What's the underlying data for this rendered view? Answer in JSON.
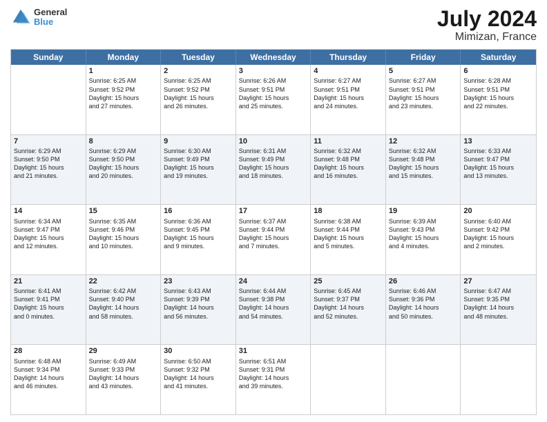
{
  "header": {
    "logo_line1": "General",
    "logo_line2": "Blue",
    "title": "July 2024",
    "subtitle": "Mimizan, France"
  },
  "weekdays": [
    "Sunday",
    "Monday",
    "Tuesday",
    "Wednesday",
    "Thursday",
    "Friday",
    "Saturday"
  ],
  "rows": [
    [
      {
        "day": "",
        "info": ""
      },
      {
        "day": "1",
        "info": "Sunrise: 6:25 AM\nSunset: 9:52 PM\nDaylight: 15 hours\nand 27 minutes."
      },
      {
        "day": "2",
        "info": "Sunrise: 6:25 AM\nSunset: 9:52 PM\nDaylight: 15 hours\nand 26 minutes."
      },
      {
        "day": "3",
        "info": "Sunrise: 6:26 AM\nSunset: 9:51 PM\nDaylight: 15 hours\nand 25 minutes."
      },
      {
        "day": "4",
        "info": "Sunrise: 6:27 AM\nSunset: 9:51 PM\nDaylight: 15 hours\nand 24 minutes."
      },
      {
        "day": "5",
        "info": "Sunrise: 6:27 AM\nSunset: 9:51 PM\nDaylight: 15 hours\nand 23 minutes."
      },
      {
        "day": "6",
        "info": "Sunrise: 6:28 AM\nSunset: 9:51 PM\nDaylight: 15 hours\nand 22 minutes."
      }
    ],
    [
      {
        "day": "7",
        "info": "Sunrise: 6:29 AM\nSunset: 9:50 PM\nDaylight: 15 hours\nand 21 minutes."
      },
      {
        "day": "8",
        "info": "Sunrise: 6:29 AM\nSunset: 9:50 PM\nDaylight: 15 hours\nand 20 minutes."
      },
      {
        "day": "9",
        "info": "Sunrise: 6:30 AM\nSunset: 9:49 PM\nDaylight: 15 hours\nand 19 minutes."
      },
      {
        "day": "10",
        "info": "Sunrise: 6:31 AM\nSunset: 9:49 PM\nDaylight: 15 hours\nand 18 minutes."
      },
      {
        "day": "11",
        "info": "Sunrise: 6:32 AM\nSunset: 9:48 PM\nDaylight: 15 hours\nand 16 minutes."
      },
      {
        "day": "12",
        "info": "Sunrise: 6:32 AM\nSunset: 9:48 PM\nDaylight: 15 hours\nand 15 minutes."
      },
      {
        "day": "13",
        "info": "Sunrise: 6:33 AM\nSunset: 9:47 PM\nDaylight: 15 hours\nand 13 minutes."
      }
    ],
    [
      {
        "day": "14",
        "info": "Sunrise: 6:34 AM\nSunset: 9:47 PM\nDaylight: 15 hours\nand 12 minutes."
      },
      {
        "day": "15",
        "info": "Sunrise: 6:35 AM\nSunset: 9:46 PM\nDaylight: 15 hours\nand 10 minutes."
      },
      {
        "day": "16",
        "info": "Sunrise: 6:36 AM\nSunset: 9:45 PM\nDaylight: 15 hours\nand 9 minutes."
      },
      {
        "day": "17",
        "info": "Sunrise: 6:37 AM\nSunset: 9:44 PM\nDaylight: 15 hours\nand 7 minutes."
      },
      {
        "day": "18",
        "info": "Sunrise: 6:38 AM\nSunset: 9:44 PM\nDaylight: 15 hours\nand 5 minutes."
      },
      {
        "day": "19",
        "info": "Sunrise: 6:39 AM\nSunset: 9:43 PM\nDaylight: 15 hours\nand 4 minutes."
      },
      {
        "day": "20",
        "info": "Sunrise: 6:40 AM\nSunset: 9:42 PM\nDaylight: 15 hours\nand 2 minutes."
      }
    ],
    [
      {
        "day": "21",
        "info": "Sunrise: 6:41 AM\nSunset: 9:41 PM\nDaylight: 15 hours\nand 0 minutes."
      },
      {
        "day": "22",
        "info": "Sunrise: 6:42 AM\nSunset: 9:40 PM\nDaylight: 14 hours\nand 58 minutes."
      },
      {
        "day": "23",
        "info": "Sunrise: 6:43 AM\nSunset: 9:39 PM\nDaylight: 14 hours\nand 56 minutes."
      },
      {
        "day": "24",
        "info": "Sunrise: 6:44 AM\nSunset: 9:38 PM\nDaylight: 14 hours\nand 54 minutes."
      },
      {
        "day": "25",
        "info": "Sunrise: 6:45 AM\nSunset: 9:37 PM\nDaylight: 14 hours\nand 52 minutes."
      },
      {
        "day": "26",
        "info": "Sunrise: 6:46 AM\nSunset: 9:36 PM\nDaylight: 14 hours\nand 50 minutes."
      },
      {
        "day": "27",
        "info": "Sunrise: 6:47 AM\nSunset: 9:35 PM\nDaylight: 14 hours\nand 48 minutes."
      }
    ],
    [
      {
        "day": "28",
        "info": "Sunrise: 6:48 AM\nSunset: 9:34 PM\nDaylight: 14 hours\nand 46 minutes."
      },
      {
        "day": "29",
        "info": "Sunrise: 6:49 AM\nSunset: 9:33 PM\nDaylight: 14 hours\nand 43 minutes."
      },
      {
        "day": "30",
        "info": "Sunrise: 6:50 AM\nSunset: 9:32 PM\nDaylight: 14 hours\nand 41 minutes."
      },
      {
        "day": "31",
        "info": "Sunrise: 6:51 AM\nSunset: 9:31 PM\nDaylight: 14 hours\nand 39 minutes."
      },
      {
        "day": "",
        "info": ""
      },
      {
        "day": "",
        "info": ""
      },
      {
        "day": "",
        "info": ""
      }
    ]
  ]
}
